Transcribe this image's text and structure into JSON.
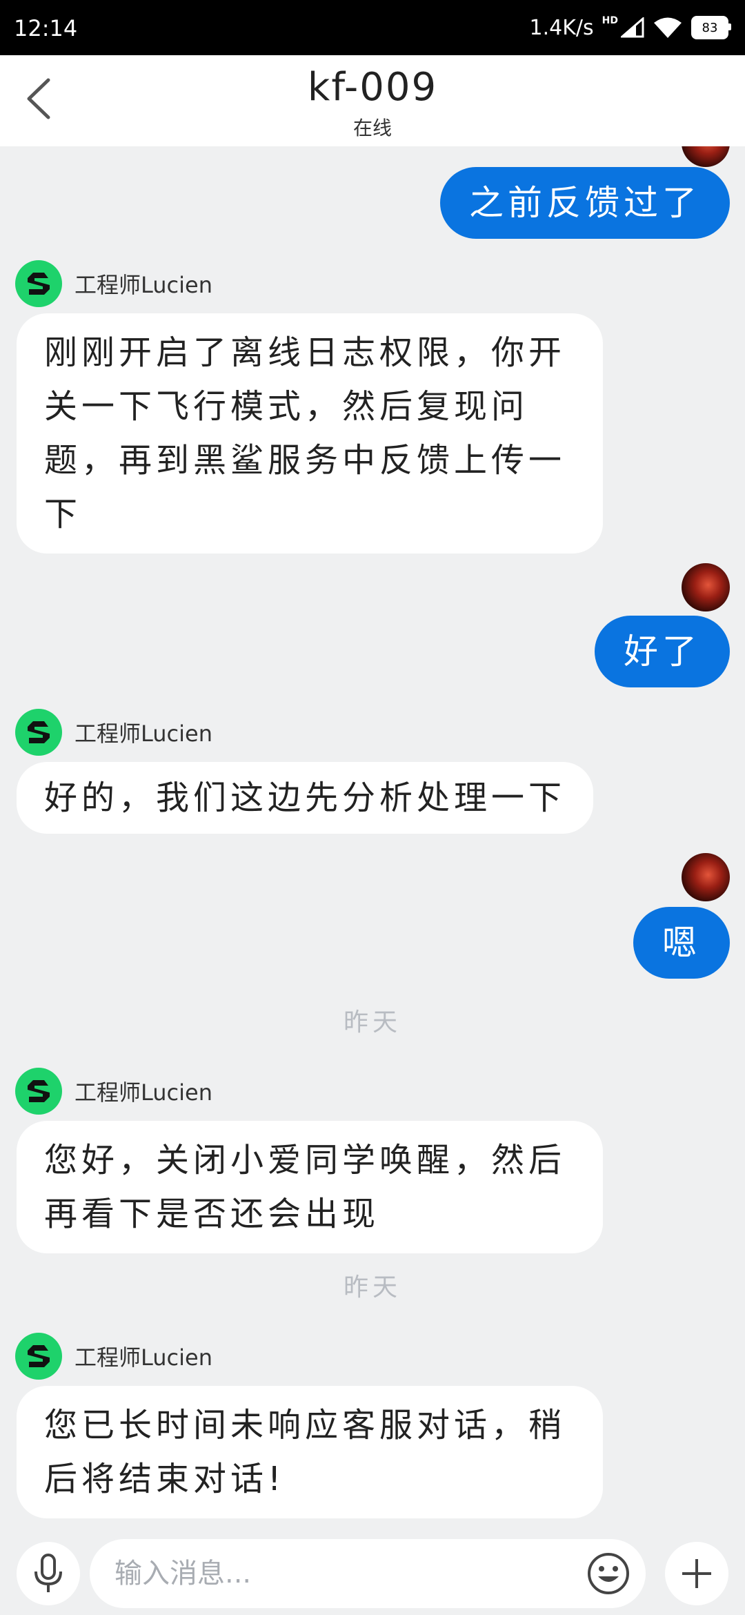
{
  "status_bar": {
    "time": "12:14",
    "network_speed": "1.4K/s",
    "network_type": "HD",
    "battery": "83",
    "icons": [
      "signal-icon",
      "wifi-icon",
      "battery-icon"
    ]
  },
  "header": {
    "title": "kf-009",
    "status": "在线",
    "back_icon": "back-chevron-icon"
  },
  "messages": [
    {
      "from": "user",
      "text": "之前反馈过了"
    },
    {
      "from": "agent",
      "name": "工程师Lucien",
      "text": "刚刚开启了离线日志权限，你开关一下飞行模式，然后复现问题，再到黑鲨服务中反馈上传一下"
    },
    {
      "from": "user",
      "text": "好了"
    },
    {
      "from": "agent",
      "name": "工程师Lucien",
      "text": "好的，我们这边先分析处理一下"
    },
    {
      "from": "user",
      "text": "嗯"
    },
    {
      "type": "date",
      "text": "昨天"
    },
    {
      "from": "agent",
      "name": "工程师Lucien",
      "text": "您好，关闭小爱同学唤醒，然后再看下是否还会出现"
    },
    {
      "type": "date",
      "text": "昨天"
    },
    {
      "from": "agent",
      "name": "工程师Lucien",
      "text": "您已长时间未响应客服对话，稍后将结束对话!"
    }
  ],
  "input_bar": {
    "placeholder": "输入消息...",
    "value": "",
    "icons": [
      "microphone-icon",
      "emoji-icon",
      "plus-icon"
    ]
  },
  "colors": {
    "user_bubble": "#0a74e0",
    "agent_avatar": "#1ed26b",
    "background": "#eff0f1"
  }
}
